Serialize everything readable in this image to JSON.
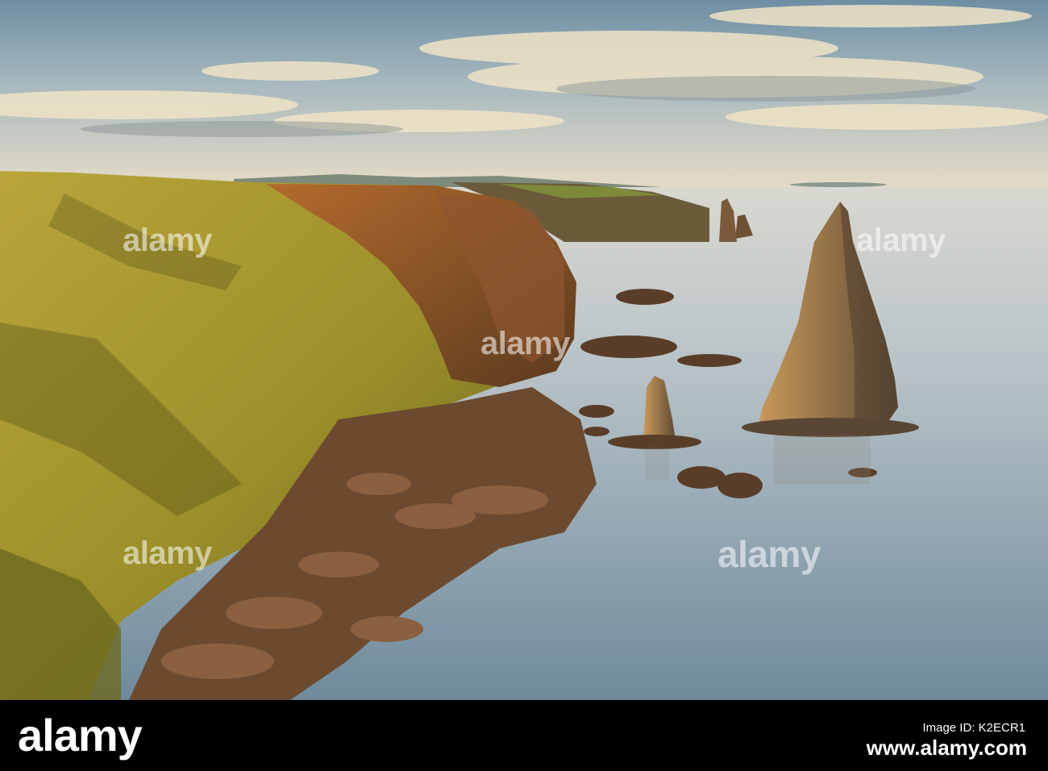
{
  "photo": {
    "subject": "coastal cliffs and sea stacks at sunset",
    "watermark_text": "alamy"
  },
  "footer": {
    "logo": "alamy",
    "image_id_label": "Image ID: K2ECR1",
    "image_id_site": "www.alamy.com"
  }
}
